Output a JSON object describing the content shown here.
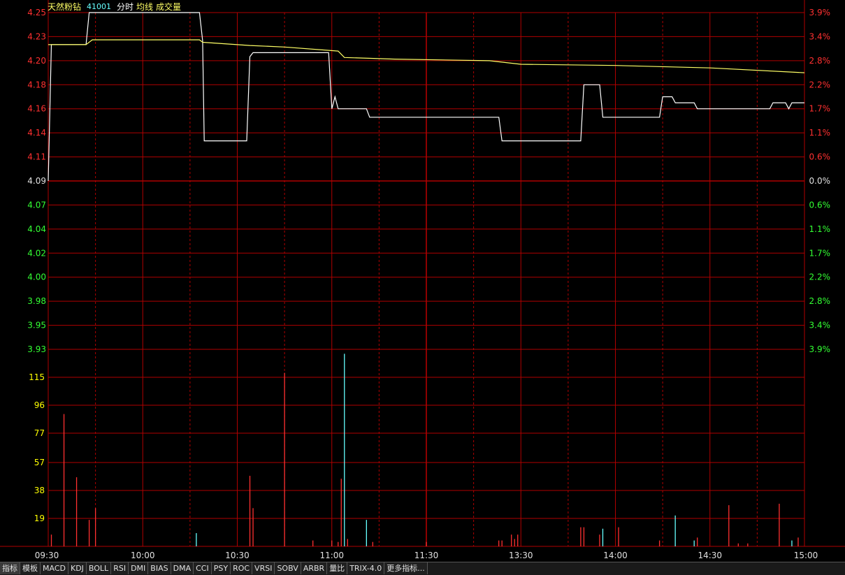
{
  "header": {
    "stock_name": "天然粉钻",
    "stock_code": "41001",
    "labels": [
      "分时",
      "均线",
      "成交量"
    ]
  },
  "colors": {
    "background": "#000000",
    "grid": "#b00000",
    "up": "#ff3030",
    "down": "#33ff33",
    "neutral": "#e0e0e0",
    "price_line": "#ffffff",
    "avg_line": "#ffff66",
    "volume_label": "#ffff00",
    "time_label": "#e0e0e0",
    "volume_down": "#66ffff"
  },
  "toolbar": {
    "items": [
      "指标",
      "模板",
      "MACD",
      "KDJ",
      "BOLL",
      "RSI",
      "DMI",
      "BIAS",
      "DMA",
      "CCI",
      "PSY",
      "ROC",
      "VRSI",
      "SOBV",
      "ARBR",
      "量比",
      "TRIX-4.0",
      "更多指标..."
    ]
  },
  "chart_data": {
    "type": "line",
    "subtype": "intraday-timeshare",
    "prev_close": 4.09,
    "price_axis": {
      "left_ticks": [
        "4.25",
        "4.23",
        "4.20",
        "4.18",
        "4.16",
        "4.14",
        "4.11",
        "4.09",
        "4.07",
        "4.04",
        "4.02",
        "4.00",
        "3.98",
        "3.95",
        "3.93"
      ],
      "right_ticks": [
        "3.9%",
        "3.4%",
        "2.8%",
        "2.2%",
        "1.7%",
        "1.1%",
        "0.6%",
        "0.0%",
        "0.6%",
        "1.1%",
        "1.7%",
        "2.2%",
        "2.8%",
        "3.4%",
        "3.9%"
      ],
      "ylim": [
        3.93,
        4.25
      ]
    },
    "time_axis": {
      "ticks": [
        "09:30",
        "10:00",
        "10:30",
        "11:00",
        "11:30",
        "13:30",
        "14:00",
        "14:30",
        "15:00"
      ],
      "range_minutes": 240
    },
    "series": [
      {
        "key": "price",
        "points": [
          [
            0,
            4.09
          ],
          [
            1,
            4.22
          ],
          [
            12,
            4.22
          ],
          [
            13,
            4.25
          ],
          [
            48,
            4.25
          ],
          [
            49,
            4.225
          ],
          [
            49.5,
            4.13
          ],
          [
            63,
            4.13
          ],
          [
            64,
            4.205
          ],
          [
            65,
            4.21
          ],
          [
            89,
            4.21
          ],
          [
            90,
            4.16
          ],
          [
            91,
            4.17
          ],
          [
            92,
            4.16
          ],
          [
            101,
            4.16
          ],
          [
            102,
            4.153
          ],
          [
            143,
            4.153
          ],
          [
            144,
            4.13
          ],
          [
            169,
            4.13
          ],
          [
            170,
            4.18
          ],
          [
            175,
            4.18
          ],
          [
            176,
            4.153
          ],
          [
            194,
            4.153
          ],
          [
            195,
            4.17
          ],
          [
            198,
            4.17
          ],
          [
            199,
            4.165
          ],
          [
            205,
            4.165
          ],
          [
            206,
            4.16
          ],
          [
            229,
            4.16
          ],
          [
            230,
            4.165
          ],
          [
            234,
            4.165
          ],
          [
            235,
            4.16
          ],
          [
            236,
            4.165
          ],
          [
            240,
            4.165
          ]
        ]
      },
      {
        "key": "average",
        "points": [
          [
            0,
            4.22
          ],
          [
            12,
            4.22
          ],
          [
            14,
            4.226
          ],
          [
            48,
            4.226
          ],
          [
            49,
            4.223
          ],
          [
            64,
            4.219
          ],
          [
            75,
            4.217
          ],
          [
            92,
            4.212
          ],
          [
            94,
            4.204
          ],
          [
            110,
            4.202
          ],
          [
            140,
            4.2
          ],
          [
            150,
            4.197
          ],
          [
            180,
            4.196
          ],
          [
            210,
            4.194
          ],
          [
            240,
            4.19
          ]
        ]
      }
    ],
    "volume": {
      "left_ticks": [
        "115",
        "96",
        "77",
        "57",
        "38",
        "19"
      ],
      "ylim": [
        0,
        134
      ],
      "bars": [
        {
          "t": 1,
          "v": 8,
          "dir": "up"
        },
        {
          "t": 5,
          "v": 90,
          "dir": "up"
        },
        {
          "t": 9,
          "v": 47,
          "dir": "up"
        },
        {
          "t": 13,
          "v": 18,
          "dir": "up"
        },
        {
          "t": 15,
          "v": 26,
          "dir": "up"
        },
        {
          "t": 47,
          "v": 9,
          "dir": "down"
        },
        {
          "t": 64,
          "v": 48,
          "dir": "up"
        },
        {
          "t": 65,
          "v": 26,
          "dir": "up"
        },
        {
          "t": 75,
          "v": 118,
          "dir": "up"
        },
        {
          "t": 84,
          "v": 4,
          "dir": "up"
        },
        {
          "t": 90,
          "v": 4,
          "dir": "up"
        },
        {
          "t": 92,
          "v": 3,
          "dir": "up"
        },
        {
          "t": 93,
          "v": 46,
          "dir": "up"
        },
        {
          "t": 94,
          "v": 131,
          "dir": "down"
        },
        {
          "t": 95,
          "v": 5,
          "dir": "up"
        },
        {
          "t": 101,
          "v": 18,
          "dir": "down"
        },
        {
          "t": 103,
          "v": 3,
          "dir": "up"
        },
        {
          "t": 120,
          "v": 3,
          "dir": "up"
        },
        {
          "t": 143,
          "v": 4,
          "dir": "up"
        },
        {
          "t": 144,
          "v": 4,
          "dir": "up"
        },
        {
          "t": 147,
          "v": 8,
          "dir": "up"
        },
        {
          "t": 148,
          "v": 5,
          "dir": "up"
        },
        {
          "t": 149,
          "v": 8,
          "dir": "up"
        },
        {
          "t": 169,
          "v": 13,
          "dir": "up"
        },
        {
          "t": 170,
          "v": 13,
          "dir": "up"
        },
        {
          "t": 175,
          "v": 8,
          "dir": "up"
        },
        {
          "t": 176,
          "v": 12,
          "dir": "down"
        },
        {
          "t": 181,
          "v": 13,
          "dir": "up"
        },
        {
          "t": 194,
          "v": 4,
          "dir": "up"
        },
        {
          "t": 199,
          "v": 21,
          "dir": "down"
        },
        {
          "t": 205,
          "v": 4,
          "dir": "down"
        },
        {
          "t": 206,
          "v": 6,
          "dir": "up"
        },
        {
          "t": 216,
          "v": 28,
          "dir": "up"
        },
        {
          "t": 219,
          "v": 2,
          "dir": "up"
        },
        {
          "t": 222,
          "v": 2,
          "dir": "up"
        },
        {
          "t": 232,
          "v": 29,
          "dir": "up"
        },
        {
          "t": 236,
          "v": 4,
          "dir": "down"
        },
        {
          "t": 238,
          "v": 6,
          "dir": "up"
        }
      ]
    }
  }
}
